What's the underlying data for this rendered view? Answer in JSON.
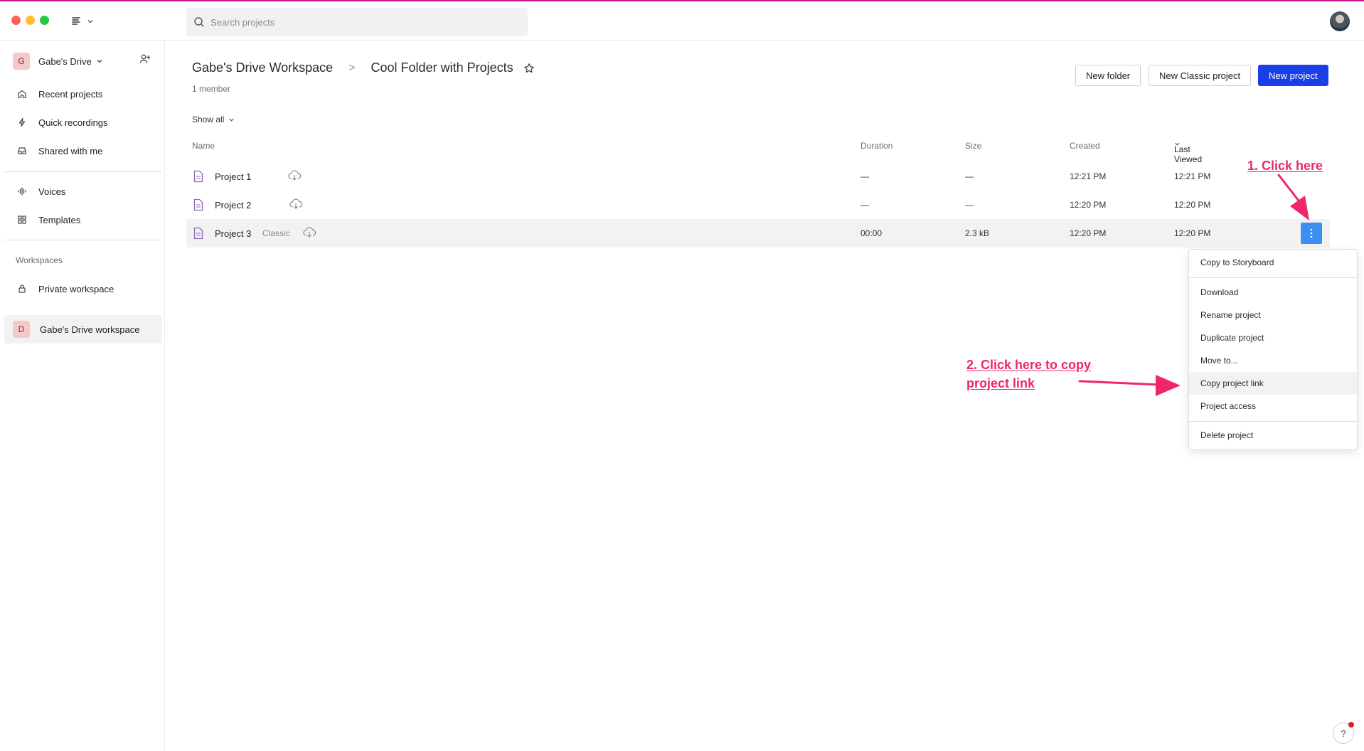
{
  "header": {
    "search_placeholder": "Search projects",
    "icons": {
      "menu": "list-icon",
      "search": "search-icon",
      "avatar": "user-avatar"
    }
  },
  "sidebar": {
    "drive": {
      "initial": "G",
      "name": "Gabe's Drive"
    },
    "items": [
      {
        "label": "Recent projects",
        "icon": "home-icon"
      },
      {
        "label": "Quick recordings",
        "icon": "lightning-icon"
      },
      {
        "label": "Shared with me",
        "icon": "inbox-icon"
      },
      {
        "label": "Voices",
        "icon": "waveform-icon"
      },
      {
        "label": "Templates",
        "icon": "grid-icon"
      }
    ],
    "workspaces_label": "Workspaces",
    "workspaces": [
      {
        "label": "Private workspace",
        "icon": "lock-icon"
      },
      {
        "label": "Gabe's Drive workspace",
        "initial": "D"
      }
    ]
  },
  "main": {
    "breadcrumb": {
      "workspace": "Gabe's Drive Workspace",
      "separator": ">",
      "folder": "Cool Folder with Projects"
    },
    "members": "1 member",
    "buttons": {
      "new_folder": "New folder",
      "new_classic": "New Classic project",
      "new_project": "New project"
    },
    "filter": "Show all",
    "columns": {
      "name": "Name",
      "duration": "Duration",
      "size": "Size",
      "created": "Created",
      "last_viewed": "Last Viewed"
    },
    "rows": [
      {
        "name": "Project 1",
        "tag": "",
        "duration": "—",
        "size": "—",
        "created": "12:21 PM",
        "last_viewed": "12:21 PM"
      },
      {
        "name": "Project 2",
        "tag": "",
        "duration": "—",
        "size": "—",
        "created": "12:20 PM",
        "last_viewed": "12:20 PM"
      },
      {
        "name": "Project 3",
        "tag": "Classic",
        "duration": "00:00",
        "size": "2.3 kB",
        "created": "12:20 PM",
        "last_viewed": "12:20 PM"
      }
    ]
  },
  "context_menu": {
    "copy_storyboard": "Copy to Storyboard",
    "download": "Download",
    "rename": "Rename project",
    "duplicate": "Duplicate project",
    "move": "Move to...",
    "copy_link": "Copy project link",
    "access": "Project access",
    "delete": "Delete project"
  },
  "annotations": {
    "step1": "1. Click here",
    "step2_line1": "2. Click here to copy",
    "step2_line2": "project link",
    "color": "#f0266b"
  },
  "help": {
    "label": "?"
  },
  "colors": {
    "primary": "#1a3ee8",
    "kebab": "#3b8ff0",
    "badge_bg": "#f7c8c8"
  }
}
